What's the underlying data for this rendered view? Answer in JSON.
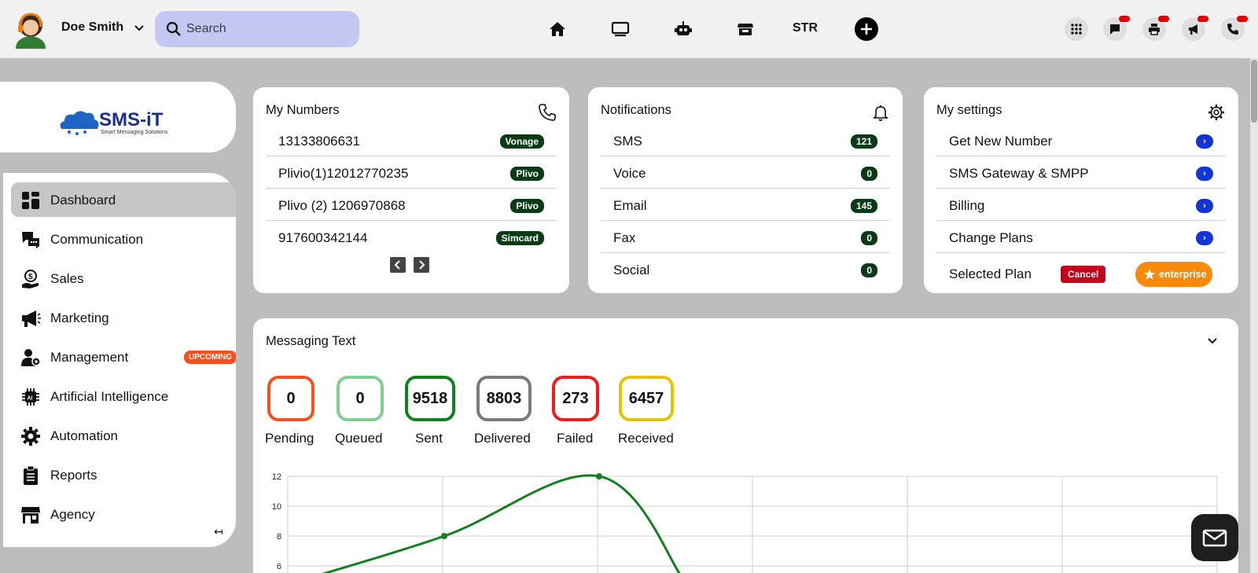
{
  "user": {
    "name": "Doe Smith"
  },
  "search": {
    "placeholder": "Search"
  },
  "topnav": {
    "str_label": "STR"
  },
  "sidebar": {
    "logo_text": "SMS-iT",
    "logo_tagline": "Smart Messaging Solutions",
    "items": [
      {
        "label": "Dashboard",
        "icon": "dashboard-icon"
      },
      {
        "label": "Communication",
        "icon": "chat-icon"
      },
      {
        "label": "Sales",
        "icon": "sales-icon"
      },
      {
        "label": "Marketing",
        "icon": "megaphone-icon"
      },
      {
        "label": "Management",
        "icon": "management-icon",
        "badge": "UPCOMING"
      },
      {
        "label": "Artificial Intelligence",
        "icon": "chip-icon"
      },
      {
        "label": "Automation",
        "icon": "gear-icon"
      },
      {
        "label": "Reports",
        "icon": "clipboard-icon"
      },
      {
        "label": "Agency",
        "icon": "store-icon"
      }
    ],
    "collapse_glyph": "↤"
  },
  "my_numbers": {
    "title": "My Numbers",
    "rows": [
      {
        "number": "13133806631",
        "provider": "Vonage"
      },
      {
        "number": "Plivio(1)12012770235",
        "provider": "Plivo"
      },
      {
        "number": "Plivo (2) 1206970868",
        "provider": "Plivo"
      },
      {
        "number": "917600342144",
        "provider": "Simcard"
      }
    ]
  },
  "notifications": {
    "title": "Notifications",
    "rows": [
      {
        "label": "SMS",
        "count": "121"
      },
      {
        "label": "Voice",
        "count": "0"
      },
      {
        "label": "Email",
        "count": "145"
      },
      {
        "label": "Fax",
        "count": "0"
      },
      {
        "label": "Social",
        "count": "0"
      }
    ]
  },
  "my_settings": {
    "title": "My settings",
    "rows": [
      {
        "label": "Get New Number"
      },
      {
        "label": "SMS Gateway & SMPP"
      },
      {
        "label": "Billing"
      },
      {
        "label": "Change Plans"
      }
    ],
    "selected_plan_label": "Selected Plan",
    "cancel_label": "Cancel",
    "plan_name": "enterprise"
  },
  "messaging": {
    "title": "Messaging Text",
    "stats": [
      {
        "label": "Pending",
        "value": "0",
        "color": "#f4511e"
      },
      {
        "label": "Queued",
        "value": "0",
        "color": "#7fcf93"
      },
      {
        "label": "Sent",
        "value": "9518",
        "color": "#13801f"
      },
      {
        "label": "Delivered",
        "value": "8803",
        "color": "#7a7a7a"
      },
      {
        "label": "Failed",
        "value": "273",
        "color": "#ee1c1c"
      },
      {
        "label": "Received",
        "value": "6457",
        "color": "#e2c400"
      }
    ]
  },
  "chart_data": {
    "type": "line",
    "title": "",
    "xlabel": "",
    "ylabel": "",
    "ylim": [
      0,
      12
    ],
    "y_ticks": [
      "12",
      "10",
      "8",
      "6"
    ],
    "grid": true,
    "series": [
      {
        "x": [
          0,
          1,
          2,
          2.55
        ],
        "values": [
          4.8,
          8,
          12,
          5
        ],
        "color": "#13801f"
      }
    ]
  }
}
